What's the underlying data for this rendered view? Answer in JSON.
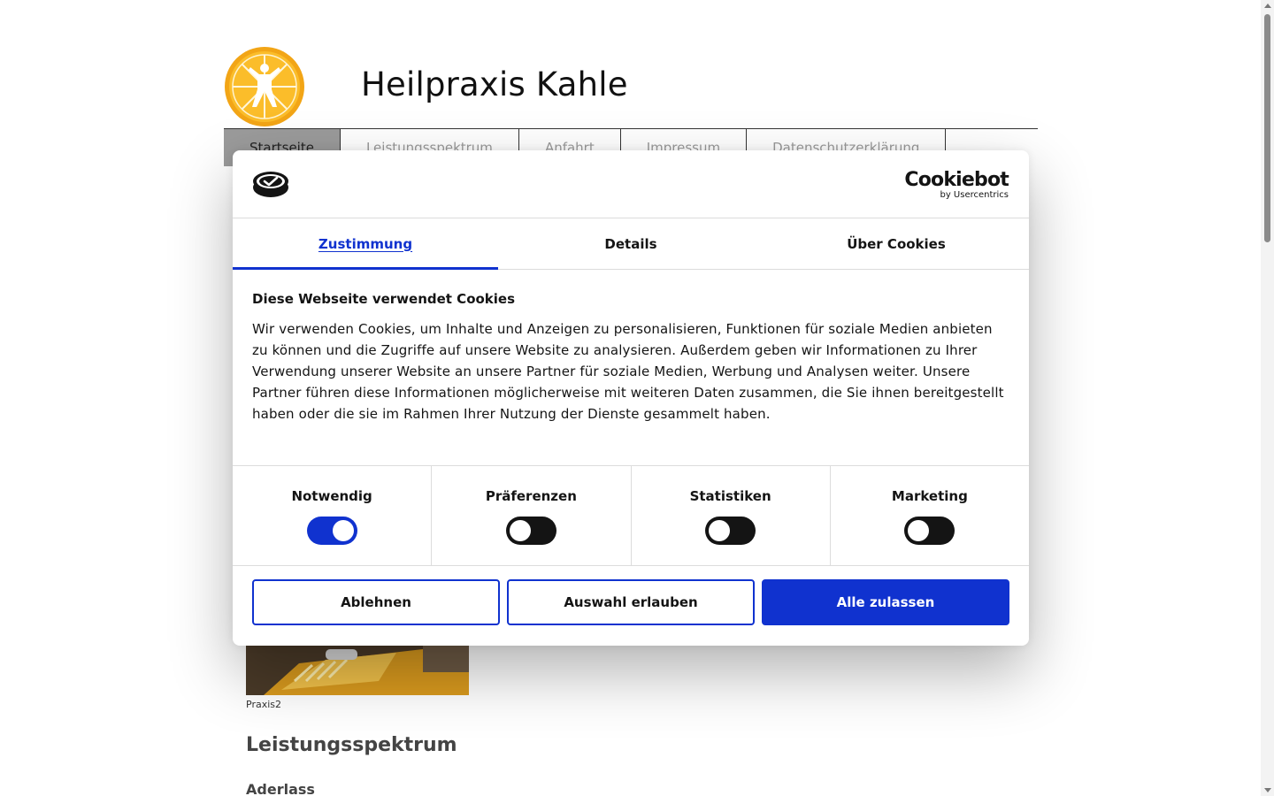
{
  "site": {
    "title": "Heilpraxis Kahle",
    "nav": [
      "Startseite",
      "Leistungsspektrum",
      "Anfahrt",
      "Impressum",
      "Datenschutzerklärung"
    ],
    "image_caption": "Praxis2",
    "section_title": "Leistungsspektrum",
    "subsection_title": "Aderlass"
  },
  "cookie_dialog": {
    "brand_name": "Cookiebot",
    "brand_sub": "by Usercentrics",
    "tabs": [
      "Zustimmung",
      "Details",
      "Über Cookies"
    ],
    "active_tab": "Zustimmung",
    "heading": "Diese Webseite verwendet Cookies",
    "text": "Wir verwenden Cookies, um Inhalte und Anzeigen zu personalisieren, Funktionen für soziale Medien anbieten zu können und die Zugriffe auf unsere Website zu analysieren. Außerdem geben wir Informationen zu Ihrer Verwendung unserer Website an unsere Partner für soziale Medien, Werbung und Analysen weiter. Unsere Partner führen diese Informationen möglicherweise mit weiteren Daten zusammen, die Sie ihnen bereitgestellt haben oder die sie im Rahmen Ihrer Nutzung der Dienste gesammelt haben.",
    "categories": [
      {
        "label": "Notwendig",
        "enabled": true
      },
      {
        "label": "Präferenzen",
        "enabled": false
      },
      {
        "label": "Statistiken",
        "enabled": false
      },
      {
        "label": "Marketing",
        "enabled": false
      }
    ],
    "buttons": {
      "decline": "Ablehnen",
      "allow_selection": "Auswahl erlauben",
      "allow_all": "Alle zulassen"
    }
  },
  "colors": {
    "accent": "#1032cf",
    "toggle_off": "#141414",
    "nav_active_bg": "#9b9b9b"
  }
}
